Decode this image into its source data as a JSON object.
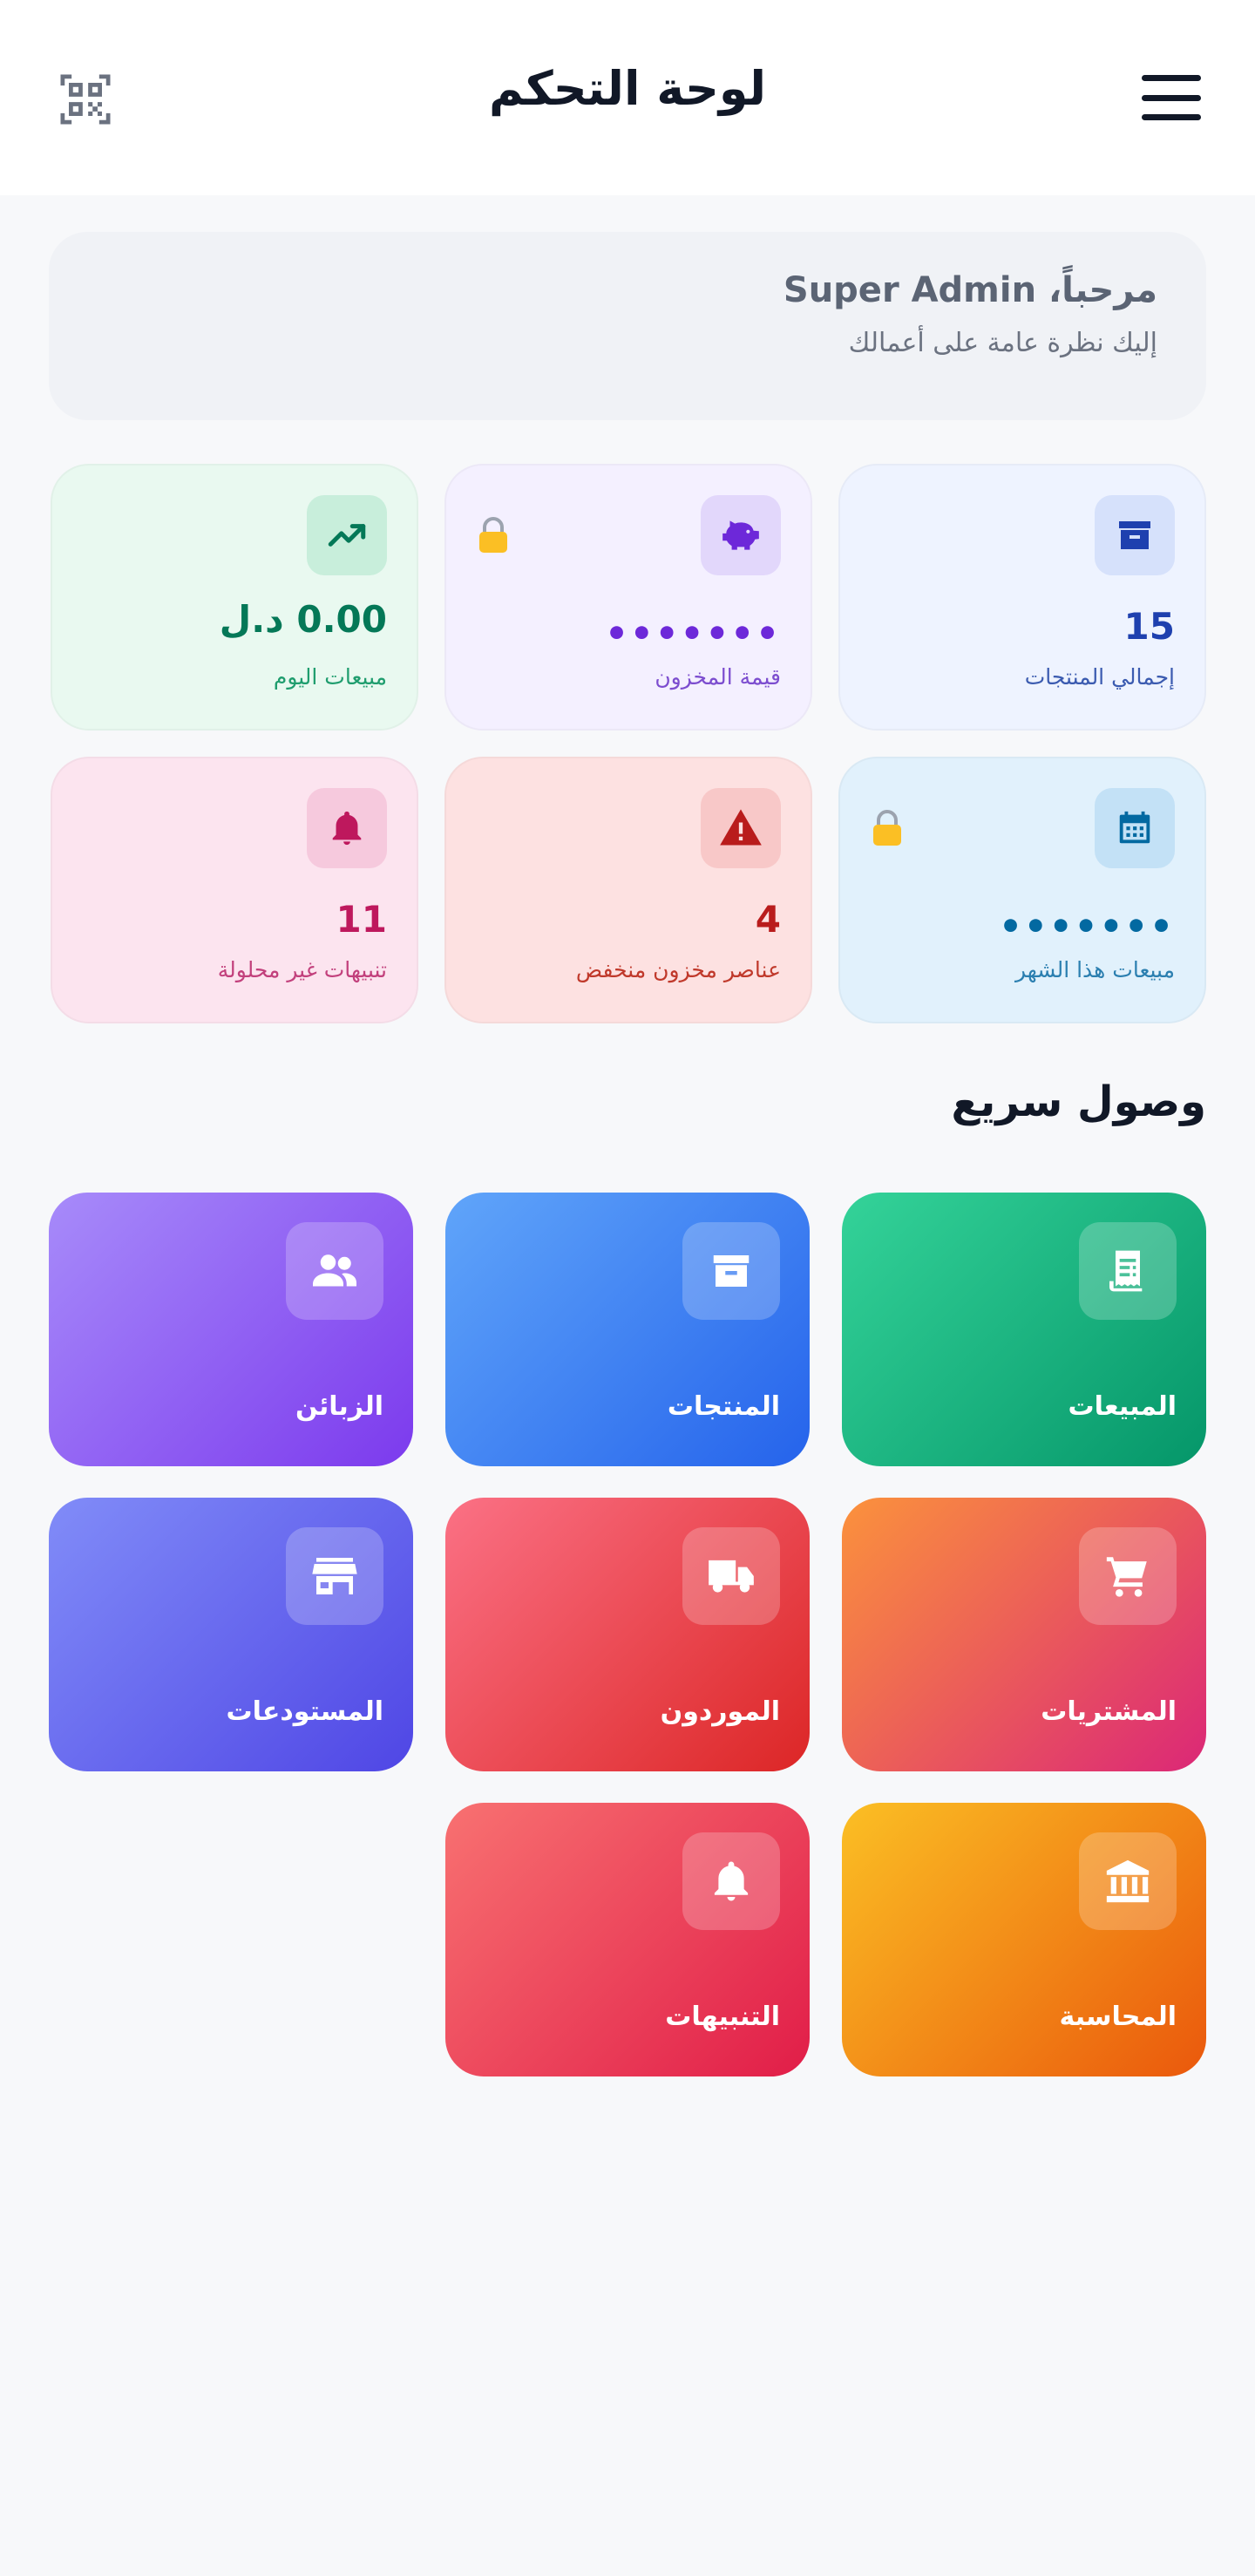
{
  "header": {
    "title": "لوحة التحكم",
    "menu_icon": "hamburger-menu-icon",
    "qr_icon": "qr-code-scan-icon"
  },
  "welcome": {
    "greeting": "مرحباً، Super Admin",
    "subtitle": "إليك نظرة عامة على أعمالك"
  },
  "stats": [
    {
      "label": "إجمالي المنتجات",
      "value": "15",
      "icon": "archive-box-icon",
      "locked": false,
      "color": "#1e40af"
    },
    {
      "label": "قيمة المخزون",
      "value": "•••••••",
      "icon": "piggy-bank-icon",
      "locked": true,
      "color": "#6d28d9"
    },
    {
      "label": "مبيعات اليوم",
      "value": "0.00 د.ل",
      "icon": "trending-up-icon",
      "locked": false,
      "color": "#047857"
    },
    {
      "label": "مبيعات هذا الشهر",
      "value": "•••••••",
      "icon": "calendar-icon",
      "locked": true,
      "color": "#0369a1"
    },
    {
      "label": "عناصر مخزون منخفض",
      "value": "4",
      "icon": "warning-triangle-icon",
      "locked": false,
      "color": "#b91c1c"
    },
    {
      "label": "تنبيهات غير محلولة",
      "value": "11",
      "icon": "bell-icon",
      "locked": false,
      "color": "#be185d"
    }
  ],
  "quick_access": {
    "title": "وصول سريع",
    "items": [
      {
        "label": "المبيعات",
        "icon": "receipt-icon"
      },
      {
        "label": "المنتجات",
        "icon": "archive-box-icon"
      },
      {
        "label": "الزبائن",
        "icon": "people-icon"
      },
      {
        "label": "المشتريات",
        "icon": "shopping-cart-icon"
      },
      {
        "label": "الموردون",
        "icon": "truck-icon"
      },
      {
        "label": "المستودعات",
        "icon": "store-icon"
      },
      {
        "label": "المحاسبة",
        "icon": "bank-icon"
      },
      {
        "label": "التنبيهات",
        "icon": "bell-icon"
      }
    ]
  },
  "colors": {
    "background": "#f7f8fa",
    "header": "#ffffff",
    "sales": "#10b981",
    "products": "#3b82f6",
    "customers": "#8b5cf6",
    "purchases": "#f97316",
    "suppliers": "#ef4444",
    "warehouses": "#6366f1",
    "accounting": "#f59e0b",
    "alerts": "#f43f5e"
  }
}
